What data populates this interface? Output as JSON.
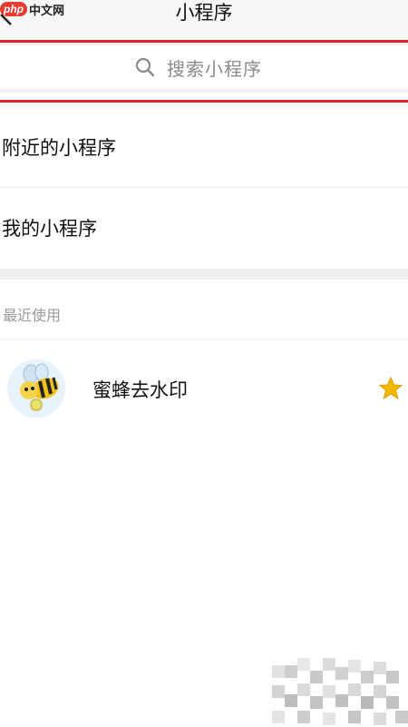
{
  "watermark": {
    "brand": "php",
    "text": "中文网"
  },
  "header": {
    "title": "小程序"
  },
  "search": {
    "placeholder": "搜索小程序"
  },
  "menu": {
    "items": [
      {
        "label": "附近的小程序"
      },
      {
        "label": "我的小程序"
      }
    ]
  },
  "recent": {
    "section_title": "最近使用",
    "apps": [
      {
        "name": "蜜蜂去水印",
        "icon": "bee-icon",
        "starred": true
      }
    ]
  },
  "colors": {
    "accent_red": "#d8262a",
    "star": "#f2b705",
    "placeholder": "#8a8a8a",
    "section_gray": "#999999"
  }
}
